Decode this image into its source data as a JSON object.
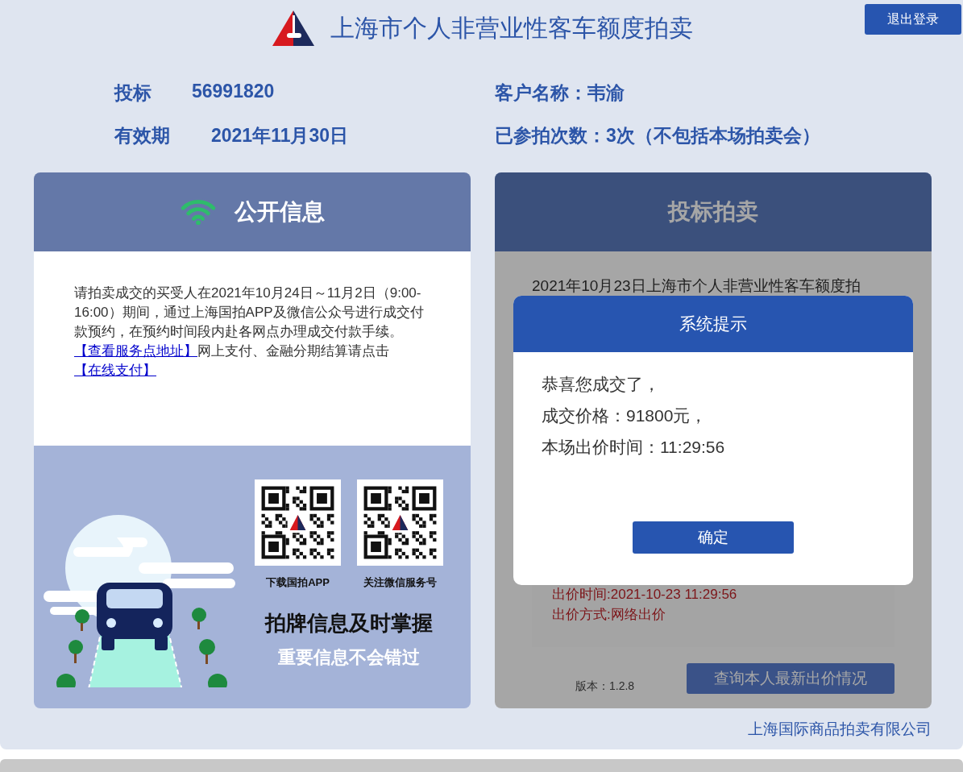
{
  "header": {
    "title": "上海市个人非营业性客车额度拍卖",
    "logout_button": "退出登录"
  },
  "info": {
    "bid_label": "投标",
    "bid_number": "56991820",
    "validity_label": "有效期",
    "validity_date": "2021年11月30日",
    "customer": "客户名称：韦渝",
    "participations": "已参拍次数：3次（不包括本场拍卖会）"
  },
  "public_panel": {
    "title": "公开信息",
    "notice": "请拍卖成交的买受人在2021年10月24日～11月2日（9:00-16:00）期间，通过上海国拍APP及微信公众号进行成交付款预约，在预约时间段内赴各网点办理成交付款手续。",
    "service_link": "【查看服务点地址】",
    "payment_text": "网上支付、金融分期结算请点击",
    "payment_link": "【在线支付】",
    "qr_codes": [
      {
        "caption": "下载国拍APP"
      },
      {
        "caption": "关注微信服务号"
      }
    ],
    "slogan": "拍牌信息及时掌握",
    "subslogan": "重要信息不会错过"
  },
  "bid_panel": {
    "title": "投标拍卖",
    "auction_line": "2021年10月23日上海市个人非营业性客车额度拍",
    "bid_time": "出价时间:2021-10-23 11:29:56",
    "bid_method": "出价方式:网络出价",
    "version": "版本：1.2.8",
    "query_button": "查询本人最新出价情况"
  },
  "dialog": {
    "title": "系统提示",
    "lines": [
      "恭喜您成交了，",
      "成交价格：91800元，",
      "本场出价时间：11:29:56"
    ],
    "confirm_button": "确定"
  },
  "footer": "上海国际商品拍卖有限公司"
}
